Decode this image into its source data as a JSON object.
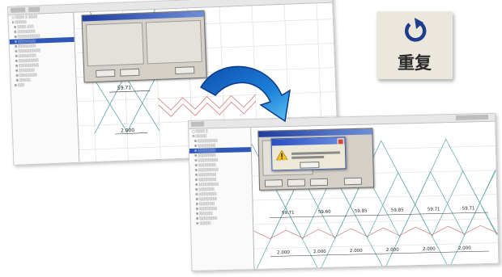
{
  "redo_button": {
    "label": "重复",
    "icon": "redo-circular-arrow-icon",
    "icon_color": "#1f3d8f"
  },
  "transition_arrow": {
    "icon": "curved-arrow-icon",
    "color": "#1b64c7"
  },
  "accent": {
    "pattern_red": "#d07a7a",
    "pattern_teal": "#5aa7a3",
    "grid": "#dcdcdc",
    "selection_blue": "#2f57b8"
  },
  "before_screenshot": {
    "dimension_labels": [
      "59.71",
      "2.000"
    ]
  },
  "after_screenshot": {
    "dimension_labels_top": [
      "59.71",
      "59.60",
      "59.85",
      "59.85",
      "59.71",
      "59.71"
    ],
    "dimension_labels_bottom": [
      "2.000",
      "2.000",
      "2.000",
      "2.000",
      "2.000",
      "2.000"
    ]
  }
}
